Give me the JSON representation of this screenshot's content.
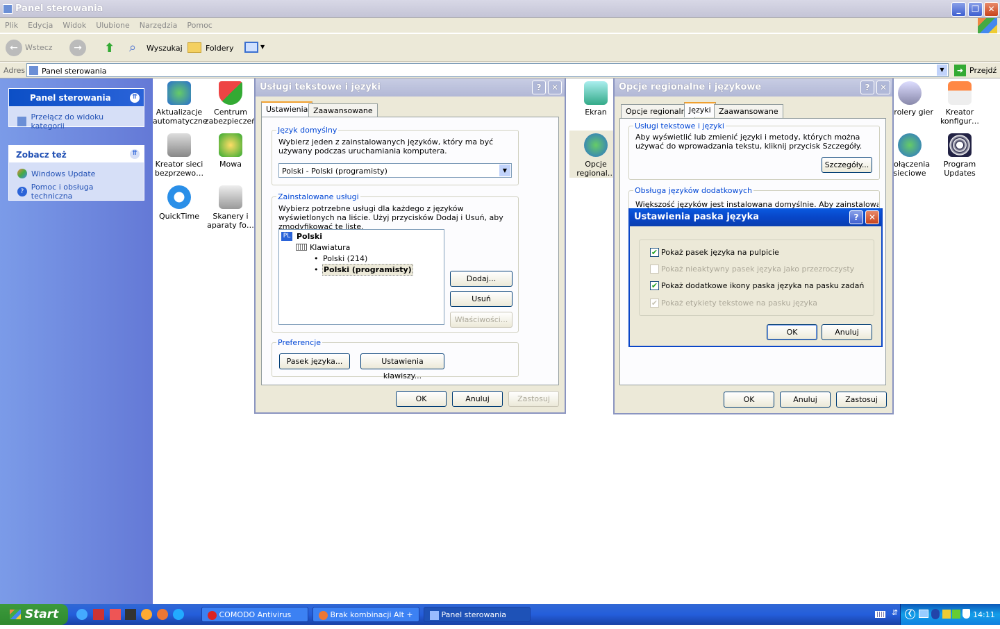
{
  "window": {
    "title": "Panel sterowania"
  },
  "menu": [
    "Plik",
    "Edycja",
    "Widok",
    "Ulubione",
    "Narzędzia",
    "Pomoc"
  ],
  "toolbar": {
    "back": "Wstecz",
    "search": "Wyszukaj",
    "folders": "Foldery"
  },
  "address": {
    "label": "Adres",
    "value": "Panel sterowania",
    "go": "Przejdź"
  },
  "sidebar": {
    "panel_title": "Panel sterowania",
    "switch_view": "Przełącz do widoku kategorii",
    "see_also_title": "Zobacz też",
    "links": [
      "Windows Update",
      "Pomoc i obsługa techniczna"
    ]
  },
  "icons": [
    {
      "line1": "Aktualizacje",
      "line2": "automatyczne"
    },
    {
      "line1": "Centrum",
      "line2": "zabezpieczeń"
    },
    {
      "line1": "Kreator sieci",
      "line2": "bezprzewo…"
    },
    {
      "line1": "Mowa",
      "line2": ""
    },
    {
      "line1": "QuickTime",
      "line2": ""
    },
    {
      "line1": "Skanery i",
      "line2": "aparaty fo…"
    },
    {
      "line1": "Ekran",
      "line2": ""
    },
    {
      "line1": "Opcje",
      "line2": "regional…"
    },
    {
      "line1": "ntrolery gier",
      "line2": ""
    },
    {
      "line1": "Kreator",
      "line2": "konfigur…"
    },
    {
      "line1": "Połączenia",
      "line2": "sieciowe"
    },
    {
      "line1": "Program",
      "line2": "Updates"
    }
  ],
  "dlg1": {
    "title": "Usługi tekstowe i języki",
    "tabs": [
      "Ustawienia",
      "Zaawansowane"
    ],
    "default_lang_label": "Język domyślny",
    "default_lang_desc": "Wybierz jeden z zainstalowanych języków, który ma być używany podczas uruchamiania komputera.",
    "default_lang_value": "Polski - Polski (programisty)",
    "installed_label": "Zainstalowane usługi",
    "installed_desc": "Wybierz potrzebne usługi dla każdego z języków wyświetlonych na liście. Użyj przycisków Dodaj i Usuń, aby zmodyfikować tę listę.",
    "tree": {
      "lang_code": "PL",
      "lang": "Polski",
      "keyboard": "Klawiatura",
      "items": [
        "Polski (214)",
        "Polski (programisty)"
      ]
    },
    "add": "Dodaj...",
    "remove": "Usuń",
    "props": "Właściwości...",
    "prefs_label": "Preferencje",
    "langbar_btn": "Pasek języka...",
    "keys_btn": "Ustawienia klawiszy...",
    "ok": "OK",
    "cancel": "Anuluj",
    "apply": "Zastosuj"
  },
  "dlg2": {
    "title": "Opcje regionalne i językowe",
    "tabs": [
      "Opcje regionalne",
      "Języki",
      "Zaawansowane"
    ],
    "text_services_label": "Usługi tekstowe i języki",
    "text_services_desc": "Aby wyświetlić lub zmienić języki i metody, których można używać do wprowadzania tekstu, kliknij przycisk Szczegóły.",
    "details": "Szczegóły...",
    "extra_label": "Obsługa języków dodatkowych",
    "extra_desc": "Większość języków jest instalowana domyślnie. Aby zainstalować języki",
    "ok": "OK",
    "cancel": "Anuluj",
    "apply": "Zastosuj"
  },
  "dlg3": {
    "title": "Ustawienia paska języka",
    "options": [
      {
        "label": "Pokaż pasek języka na pulpicie",
        "checked": true,
        "enabled": true
      },
      {
        "label": "Pokaż nieaktywny pasek języka jako przezroczysty",
        "checked": false,
        "enabled": false
      },
      {
        "label": "Pokaż dodatkowe ikony paska języka na pasku zadań",
        "checked": true,
        "enabled": true
      },
      {
        "label": "Pokaż etykiety tekstowe na pasku języka",
        "checked": true,
        "enabled": false
      }
    ],
    "ok": "OK",
    "cancel": "Anuluj"
  },
  "taskbar": {
    "start": "Start",
    "tasks": [
      "COMODO Antivirus",
      "Brak kombinacji Alt + …",
      "Panel sterowania"
    ],
    "clock": "14:11"
  },
  "colors": {
    "xp_blue": "#0a46c8",
    "sidebar": "#6f8ae0",
    "dialog_bg": "#ece9d8"
  }
}
